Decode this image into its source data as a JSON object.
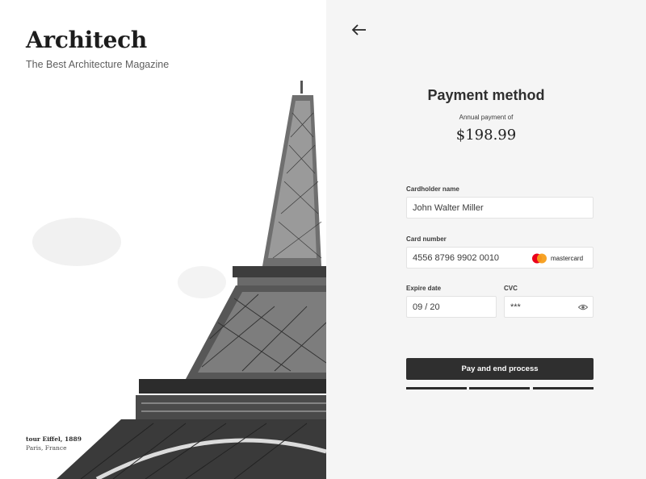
{
  "brand": {
    "name": "Architech",
    "tagline": "The Best Architecture Magazine"
  },
  "photo": {
    "caption_title": "tour Eiffel, 1889",
    "caption_location": "Paris, France"
  },
  "payment": {
    "back_icon": "arrow-left-icon",
    "title": "Payment method",
    "subtitle": "Annual payment of",
    "amount": "$198.99",
    "cardholder_label": "Cardholder name",
    "cardholder_value": "John Walter Miller",
    "card_number_label": "Card number",
    "card_number_value": "4556 8796 9902 0010",
    "card_brand": "mastercard",
    "expire_label": "Expire date",
    "expire_value": "09 / 20",
    "cvc_label": "CVC",
    "cvc_value": "***",
    "cvc_icon": "eye-icon",
    "pay_button": "Pay and end process",
    "steps_total": 3,
    "steps_completed": 3
  },
  "colors": {
    "panel_background": "#f5f5f5",
    "button_background": "#2f2f2f",
    "mastercard_red": "#eb001b",
    "mastercard_orange": "#f79e1b"
  }
}
